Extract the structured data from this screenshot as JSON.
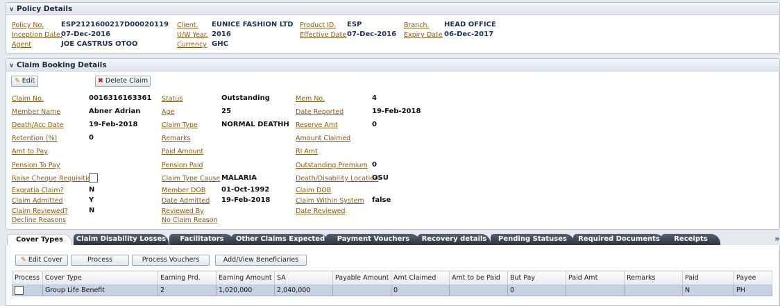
{
  "policy": {
    "header": "Policy Details",
    "fields": [
      {
        "label": "Policy No.",
        "value": "ESP2121600217D00020119"
      },
      {
        "label": "Inception Date.",
        "value": "07-Dec-2016"
      },
      {
        "label": "Agent",
        "value": "JOE CASTRUS OTOO"
      },
      {
        "label": "Client.",
        "value": "EUNICE FASHION LTD"
      },
      {
        "label": "U/W Year.",
        "value": "2016"
      },
      {
        "label": "Currency",
        "value": "GHC"
      },
      {
        "label": "Product ID.",
        "value": "ESP"
      },
      {
        "label": "Effective Date",
        "value": "07-Dec-2016"
      },
      {
        "label": "Branch.",
        "value": "HEAD OFFICE"
      },
      {
        "label": "Expiry Date",
        "value": "06-Dec-2017"
      }
    ]
  },
  "claim": {
    "header": "Claim Booking Details",
    "edit_label": "Edit",
    "delete_label": "Delete Claim",
    "col1": [
      {
        "label": "Claim No.",
        "value": "0016316163361"
      },
      {
        "label": "Member Name",
        "value": "Abner Adrian"
      },
      {
        "label": "Death/Acc Date",
        "value": "19-Feb-2018"
      },
      {
        "label": "Retention (%)",
        "value": "0"
      },
      {
        "label": "Amt to Pay",
        "value": ""
      },
      {
        "label": "Pension To Pay",
        "value": ""
      },
      {
        "label": "Raise Cheque Requisition",
        "value": ""
      },
      {
        "label": "Exgratia Claim?",
        "value": "N"
      },
      {
        "label": "Claim Admitted",
        "value": "Y"
      },
      {
        "label": "Claim Reviewed?",
        "value": "N"
      },
      {
        "label": "Decline Reasons",
        "value": ""
      }
    ],
    "col2": [
      {
        "label": "Status",
        "value": "Outstanding"
      },
      {
        "label": "Age",
        "value": "25"
      },
      {
        "label": "Claim Type",
        "value": "NORMAL DEATHH"
      },
      {
        "label": "Remarks",
        "value": ""
      },
      {
        "label": "Paid Amount",
        "value": ""
      },
      {
        "label": "Pension Paid",
        "value": ""
      },
      {
        "label": "Claim Type Cause",
        "value": "MALARIA"
      },
      {
        "label": "Member DOB",
        "value": "01-Oct-1992"
      },
      {
        "label": "Date Admitted",
        "value": "19-Feb-2018"
      },
      {
        "label": "Reviewed By",
        "value": ""
      },
      {
        "label": "No Claim Reason",
        "value": ""
      }
    ],
    "col3": [
      {
        "label": "Mem No.",
        "value": "4"
      },
      {
        "label": "Date Reported",
        "value": "19-Feb-2018"
      },
      {
        "label": "Reserve Amt",
        "value": "0"
      },
      {
        "label": "Amount Claimed",
        "value": ""
      },
      {
        "label": "RI Amt",
        "value": ""
      },
      {
        "label": "Outstanding Premium",
        "value": "0"
      },
      {
        "label": "Death/Disability Location",
        "value": "OSU"
      },
      {
        "label": "Claim DOB",
        "value": ""
      },
      {
        "label": "Claim Within System",
        "value": "false"
      },
      {
        "label": "Date Reviewed",
        "value": ""
      }
    ]
  },
  "tabs": [
    "Cover Types",
    "Claim Disability Losses",
    "Facilitators",
    "Other Claims Expected",
    "Payment Vouchers",
    "Recovery details",
    "Pending Statuses",
    "Required Documents",
    "Receipts"
  ],
  "tab_overflow": "»",
  "cover": {
    "buttons": [
      "Edit Cover",
      "Process",
      "Process Vouchers",
      "Add/View Beneficiaries"
    ],
    "columns": [
      "Process",
      "Cover Type",
      "Earning Prd.",
      "Earning Amount",
      "SA",
      "Payable Amount",
      "Amt Claimed",
      "Amt to be Paid",
      "But Pay",
      "Paid Amt",
      "Remarks",
      "Paid",
      "Payee"
    ],
    "rows": [
      [
        "",
        "Group Life Benefit",
        "2",
        "1,020,000",
        "2,040,000",
        "",
        "0",
        "",
        "0",
        "",
        "",
        "N",
        "PH"
      ]
    ]
  }
}
